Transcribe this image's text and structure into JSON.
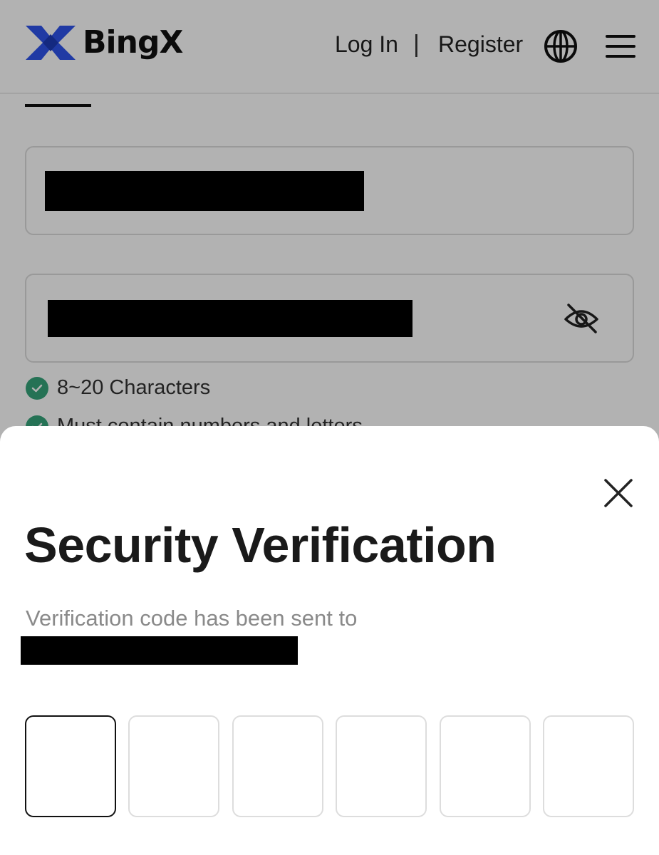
{
  "header": {
    "brand": "BingX",
    "login_label": "Log In",
    "separator": "|",
    "register_label": "Register",
    "icons": [
      "bingx-logo-icon",
      "globe-icon",
      "hamburger-menu-icon"
    ],
    "brand_color": "#2f54eb"
  },
  "form": {
    "email_value": "[redacted]",
    "password_value": "[redacted]",
    "password_toggle_icon": "eye-off-icon",
    "rules": [
      {
        "text": "8~20 Characters",
        "icon": "check-circle-icon",
        "color": "#36a47a"
      },
      {
        "text": "Must contain numbers and letters",
        "icon": "check-circle-icon",
        "color": "#36a47a"
      }
    ]
  },
  "sheet": {
    "title": "Security Verification",
    "subtitle": "Verification code has been sent to",
    "destination": "[redacted]",
    "close_icon": "close-icon",
    "code_digits": [
      "",
      "",
      "",
      "",
      "",
      ""
    ],
    "active_digit": 1
  }
}
